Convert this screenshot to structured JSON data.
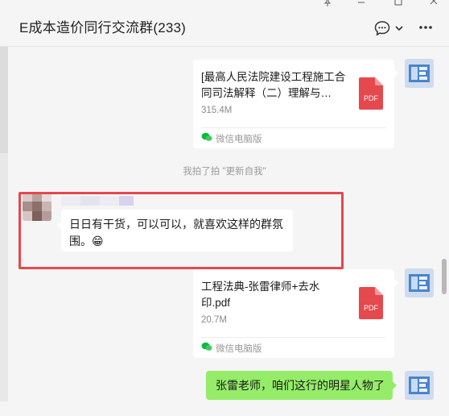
{
  "window": {
    "pin_icon": "pin-icon",
    "minimize_icon": "minimize-icon",
    "maximize_icon": "maximize-icon",
    "close_icon": "close-icon"
  },
  "header": {
    "title": "E成本造价同行交流群(233)",
    "chat_icon": "chat-bubble-icon",
    "more_icon": "chevron-down-icon"
  },
  "messages": {
    "file1": {
      "name": "[最高人民法院建设工程施工合同司法解释（二）理解与…",
      "size": "315.4M",
      "file_type": "PDF",
      "source": "微信电脑版"
    },
    "system": {
      "text": "我拍了拍 \"更新自我\""
    },
    "incoming": {
      "text": "日日有干货，可以可以，就喜欢这样的群氛围。",
      "emoji": "😁"
    },
    "file2": {
      "name": "工程法典-张雷律师+去水印.pdf",
      "size": "20.7M",
      "file_type": "PDF",
      "source": "微信电脑版"
    },
    "outgoing": {
      "text": "张雷老师，咱们这行的明星人物了"
    }
  },
  "colors": {
    "pdf_red": "#e5484d",
    "highlight_red": "#e5484d",
    "bubble_green": "#95ec69",
    "avatar_blue": "#3f78c8"
  }
}
